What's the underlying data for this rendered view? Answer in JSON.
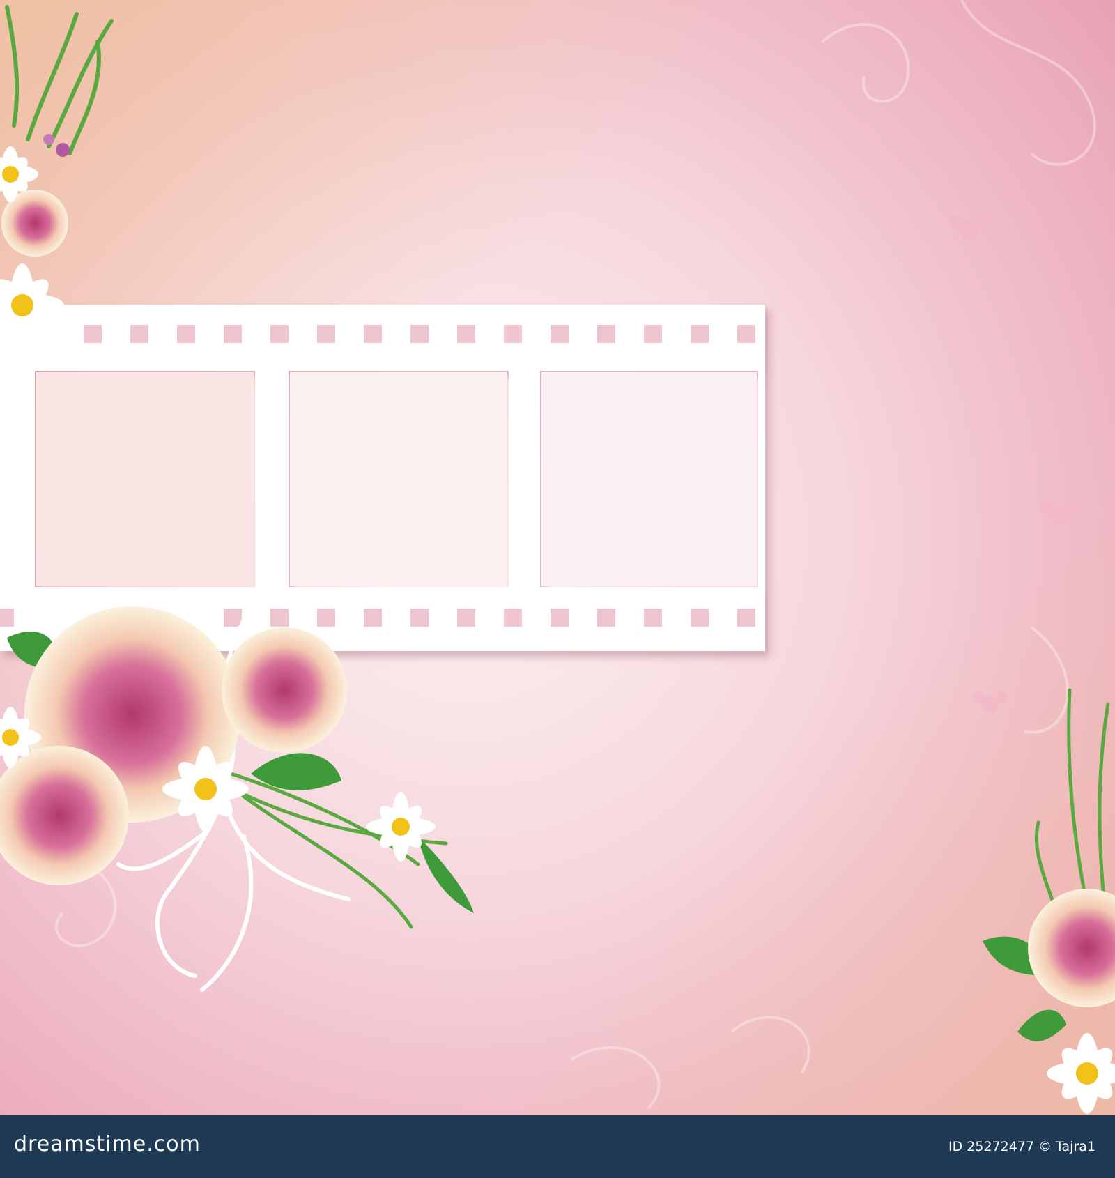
{
  "image": {
    "description_free": true,
    "colors": {
      "background_pink": "#f2c4cf",
      "background_peach": "#f0c9a8",
      "background_center": "#fbeef0",
      "film": "#ffffff",
      "footer": "#1e3a55",
      "rose_outer": "#fbf1dd",
      "rose_center": "#c9507e",
      "daisy_petal": "#ffffff",
      "daisy_center": "#f2c21a",
      "leaf": "#3f9a3a"
    },
    "icons": [
      "filmstrip-icon",
      "rose-icon",
      "daisy-icon",
      "leaf-icon",
      "swirl-icon"
    ]
  },
  "footer": {
    "logo_text": "dreamstime.com",
    "id_text": "ID 25272477 © Tajra1"
  }
}
